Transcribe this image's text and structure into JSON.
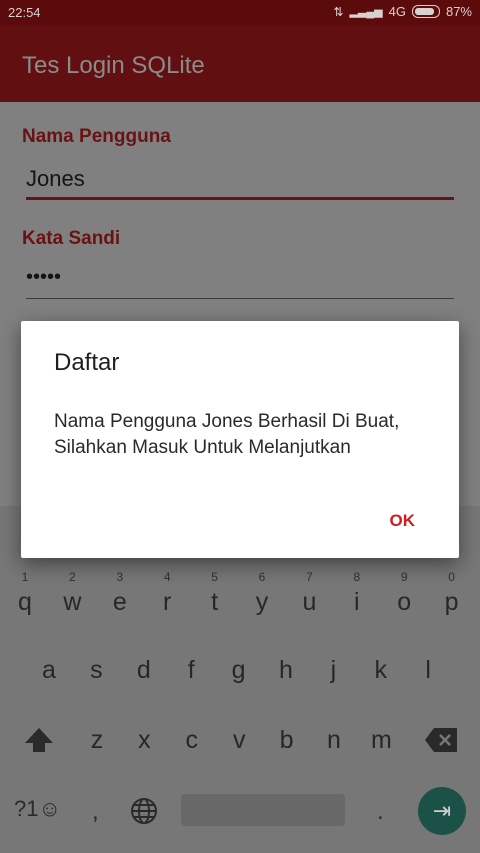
{
  "status_bar": {
    "time": "22:54",
    "network": "4G",
    "battery": "87%"
  },
  "app_bar": {
    "title": "Tes Login SQLite"
  },
  "form": {
    "username_label": "Nama Pengguna",
    "username_value": "Jones",
    "password_label": "Kata Sandi",
    "password_value": "•••••"
  },
  "dialog": {
    "title": "Daftar",
    "message": "Nama Pengguna Jones Berhasil Di Buat, Silahkan Masuk Untuk Melanjutkan",
    "ok_label": "OK"
  },
  "keyboard": {
    "row1": [
      "q",
      "w",
      "e",
      "r",
      "t",
      "y",
      "u",
      "i",
      "o",
      "p"
    ],
    "row1_hints": [
      "1",
      "2",
      "3",
      "4",
      "5",
      "6",
      "7",
      "8",
      "9",
      "0"
    ],
    "row2": [
      "a",
      "s",
      "d",
      "f",
      "g",
      "h",
      "j",
      "k",
      "l"
    ],
    "row3": [
      "z",
      "x",
      "c",
      "v",
      "b",
      "n",
      "m"
    ],
    "symbols_label": "?1☺",
    "comma_label": ",",
    "period_label": "."
  },
  "colors": {
    "accent": "#d01b1f",
    "app_bar": "#620f12",
    "dim_overlay": "#808080"
  }
}
